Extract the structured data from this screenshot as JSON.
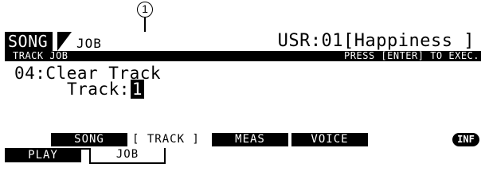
{
  "callout": {
    "number": "1"
  },
  "header": {
    "mode": "SONG",
    "submode": "JOB",
    "song_title": "USR:01[Happiness  ]"
  },
  "status_bar": {
    "left": "TRACK JOB",
    "right": "PRESS [ENTER] TO EXEC."
  },
  "job": {
    "title": "04:Clear Track",
    "param_label": "Track:",
    "param_value": "1"
  },
  "function_tabs": {
    "song": "SONG",
    "track": "[ TRACK ]",
    "meas": "MEAS",
    "voice": "VOICE",
    "info": "INF"
  },
  "bottom_tabs": {
    "play": "PLAY",
    "job": "JOB"
  }
}
